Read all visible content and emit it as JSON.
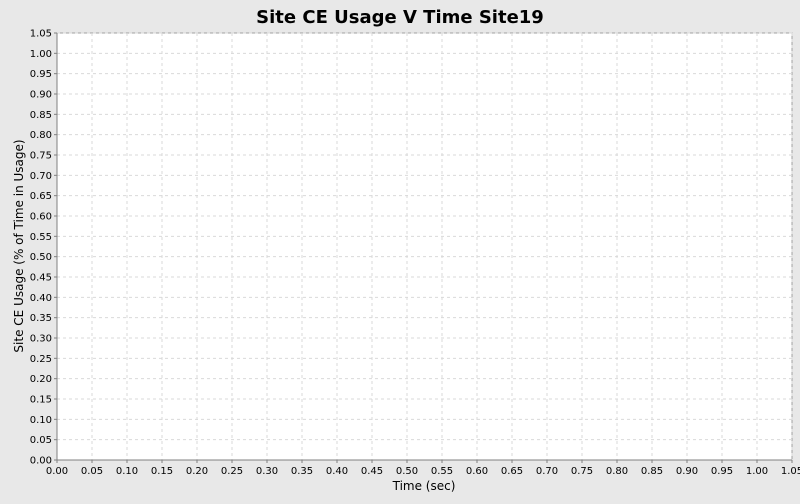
{
  "chart_data": {
    "type": "line",
    "title": "Site CE Usage V Time Site19",
    "xlabel": "Time (sec)",
    "ylabel": "Site CE Usage (% of Time in Usage)",
    "xlim": [
      0,
      1.05
    ],
    "ylim": [
      0,
      1.05
    ],
    "x_ticks": [
      "0.00",
      "0.05",
      "0.10",
      "0.15",
      "0.20",
      "0.25",
      "0.30",
      "0.35",
      "0.40",
      "0.45",
      "0.50",
      "0.55",
      "0.60",
      "0.65",
      "0.70",
      "0.75",
      "0.80",
      "0.85",
      "0.90",
      "0.95",
      "1.00",
      "1.05"
    ],
    "y_ticks": [
      "0.00",
      "0.05",
      "0.10",
      "0.15",
      "0.20",
      "0.25",
      "0.30",
      "0.35",
      "0.40",
      "0.45",
      "0.50",
      "0.55",
      "0.60",
      "0.65",
      "0.70",
      "0.75",
      "0.80",
      "0.85",
      "0.90",
      "0.95",
      "1.00",
      "1.05"
    ],
    "grid": true,
    "series": [],
    "colors": {
      "background": "#e8e8e8",
      "plot_background": "#ffffff",
      "gridline": "#d9d9d9",
      "axis": "#808080",
      "text": "#000000"
    }
  }
}
